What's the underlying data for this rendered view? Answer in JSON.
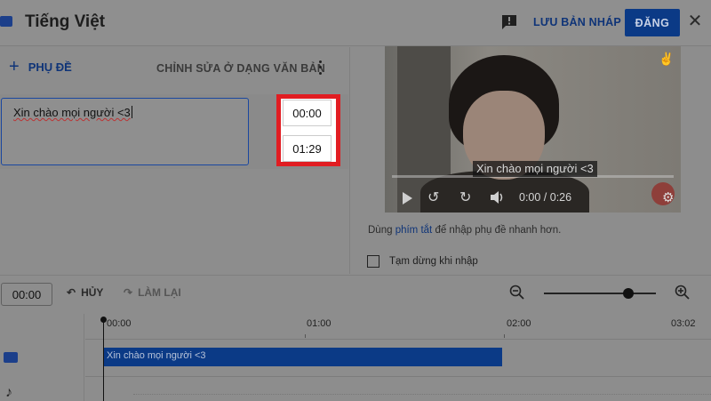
{
  "header": {
    "title": "Tiếng Việt",
    "save_draft": "LƯU BẢN NHÁP",
    "publish": "ĐĂNG",
    "close": "✕"
  },
  "editor": {
    "add_subtitle": "PHỤ ĐỀ",
    "edit_as_text": "CHỈNH SỬA Ở DẠNG VĂN BẢN",
    "subtitle_text": "Xin chào mọi người <3",
    "start_time": "00:00",
    "end_time": "01:29"
  },
  "player": {
    "caption": "Xin chào mọi người <3",
    "time_readout": "0:00 / 0:26"
  },
  "hint": {
    "prefix": "Dùng ",
    "link": "phím tắt",
    "suffix": " để nhập phụ đề nhanh hơn."
  },
  "pause_while_typing": {
    "label": "Tạm dừng khi nhập",
    "checked": false
  },
  "timeline_toolbar": {
    "current_time": "00:00",
    "undo": "HỦY",
    "redo": "LÀM LẠI",
    "zoom_level": 0.75
  },
  "timeline": {
    "ruler": [
      "00:00",
      "01:00",
      "02:00",
      "03:02"
    ],
    "segment_text": "Xin chào mọi người <3"
  },
  "colors": {
    "accent": "#0b3a86",
    "highlight": "#e11d22"
  }
}
